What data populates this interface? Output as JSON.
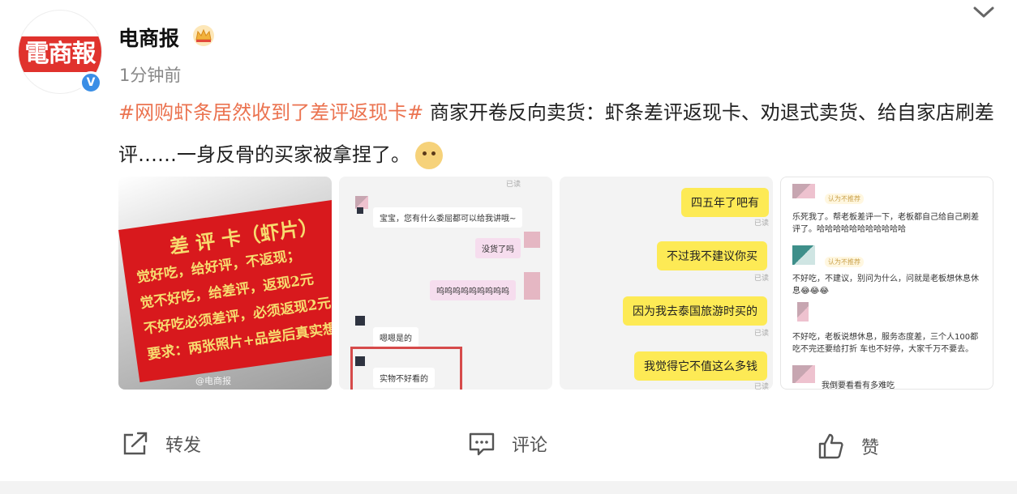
{
  "author": {
    "name": "电商报",
    "logo_text": "電商報",
    "verified_mark": "V",
    "timestamp": "1分钟前"
  },
  "post": {
    "hashtag": "#网购虾条居然收到了差评返现卡#",
    "body": " 商家开卷反向卖货：虾条差评返现卡、劝退式卖货、给自家店刷差评……一身反骨的买家被拿捏了。"
  },
  "image1": {
    "card_lines": [
      "差 评 卡（虾片）",
      "觉好吃，给好评，不返现；",
      "觉不好吃，给差评，返现2元",
      "不好吃必须差评，必须返现2元",
      "要求：两张照片+品尝后真实想"
    ],
    "watermark": "@电商报"
  },
  "image2": {
    "read": "已读",
    "messages": [
      "宝宝，您有什么委屈都可以给我讲哦~",
      "没货了吗",
      "呜呜呜呜呜呜呜呜呜",
      "嗯嗯是的",
      "实物不好看的"
    ]
  },
  "image3": {
    "read": "已读",
    "messages": [
      "四五年了吧有",
      "不过我不建议你买",
      "因为我去泰国旅游时买的",
      "我觉得它不值这么多钱"
    ]
  },
  "image4": {
    "badge": "认为不推荐",
    "comments": [
      "乐死我了。帮老板差评一下，老板都自己给自己刷差评了。哈哈哈哈哈哈哈哈哈哈哈",
      "不好吃，不建议，别问为什么，问就是老板想休息休息😂😂😂",
      "不好吃，老板说想休息，服务态度差，三个人100都吃不完还要给打折 车也不好停，大家千万不要去。",
      "我倒要看看有多难吃"
    ]
  },
  "actions": {
    "share": "转发",
    "comment": "评论",
    "like": "赞"
  },
  "icons": [
    "crown-icon",
    "chevron-down-icon",
    "share-icon",
    "comment-icon",
    "like-icon",
    "verified-icon"
  ],
  "colors": {
    "hashtag": "#eb7350",
    "verified": "#3a8ee6",
    "chat_yellow": "#fdea55"
  }
}
